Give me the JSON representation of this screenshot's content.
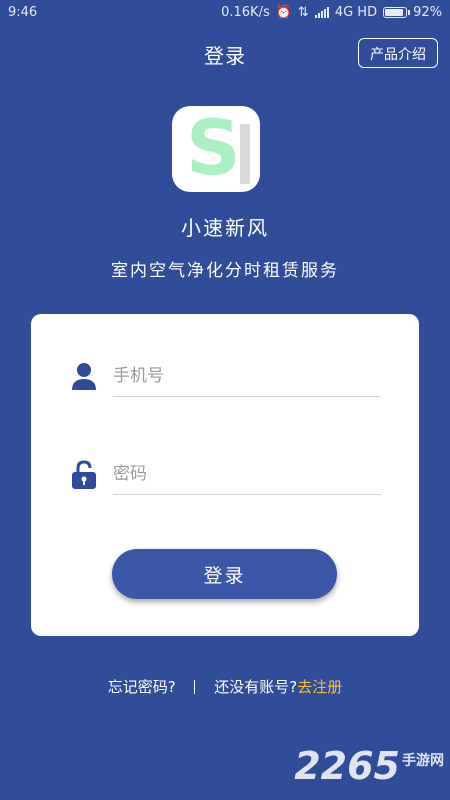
{
  "status_bar": {
    "time": "9:46",
    "speed": "0.16K/s",
    "network": "4G HD",
    "battery": "92%",
    "battery_level": 0.92
  },
  "header": {
    "title": "登录",
    "product_button": "产品介绍"
  },
  "app": {
    "logo_letter": "S",
    "name": "小速新风",
    "slogan": "室内空气净化分时租赁服务"
  },
  "form": {
    "phone_placeholder": "手机号",
    "password_placeholder": "密码",
    "login_button": "登录"
  },
  "links": {
    "forgot": "忘记密码?",
    "no_account": "还没有账号?",
    "register": "去注册"
  },
  "watermark": {
    "brand": "2265",
    "sub": "手游网"
  },
  "colors": {
    "background": "#304d99",
    "button": "#3b57a8",
    "icon": "#2f4a98",
    "register_link": "#f3c138",
    "logo_letter": "#a9f0c4"
  }
}
